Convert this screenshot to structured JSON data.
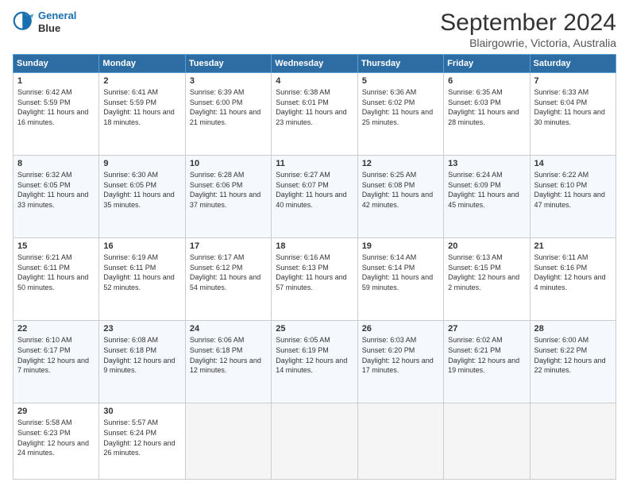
{
  "header": {
    "logo_line1": "General",
    "logo_line2": "Blue",
    "title": "September 2024",
    "subtitle": "Blairgowrie, Victoria, Australia"
  },
  "days_of_week": [
    "Sunday",
    "Monday",
    "Tuesday",
    "Wednesday",
    "Thursday",
    "Friday",
    "Saturday"
  ],
  "weeks": [
    [
      {
        "day": "1",
        "rise": "6:42 AM",
        "set": "5:59 PM",
        "daylight": "11 hours and 16 minutes."
      },
      {
        "day": "2",
        "rise": "6:41 AM",
        "set": "5:59 PM",
        "daylight": "11 hours and 18 minutes."
      },
      {
        "day": "3",
        "rise": "6:39 AM",
        "set": "6:00 PM",
        "daylight": "11 hours and 21 minutes."
      },
      {
        "day": "4",
        "rise": "6:38 AM",
        "set": "6:01 PM",
        "daylight": "11 hours and 23 minutes."
      },
      {
        "day": "5",
        "rise": "6:36 AM",
        "set": "6:02 PM",
        "daylight": "11 hours and 25 minutes."
      },
      {
        "day": "6",
        "rise": "6:35 AM",
        "set": "6:03 PM",
        "daylight": "11 hours and 28 minutes."
      },
      {
        "day": "7",
        "rise": "6:33 AM",
        "set": "6:04 PM",
        "daylight": "11 hours and 30 minutes."
      }
    ],
    [
      {
        "day": "8",
        "rise": "6:32 AM",
        "set": "6:05 PM",
        "daylight": "11 hours and 33 minutes."
      },
      {
        "day": "9",
        "rise": "6:30 AM",
        "set": "6:05 PM",
        "daylight": "11 hours and 35 minutes."
      },
      {
        "day": "10",
        "rise": "6:28 AM",
        "set": "6:06 PM",
        "daylight": "11 hours and 37 minutes."
      },
      {
        "day": "11",
        "rise": "6:27 AM",
        "set": "6:07 PM",
        "daylight": "11 hours and 40 minutes."
      },
      {
        "day": "12",
        "rise": "6:25 AM",
        "set": "6:08 PM",
        "daylight": "11 hours and 42 minutes."
      },
      {
        "day": "13",
        "rise": "6:24 AM",
        "set": "6:09 PM",
        "daylight": "11 hours and 45 minutes."
      },
      {
        "day": "14",
        "rise": "6:22 AM",
        "set": "6:10 PM",
        "daylight": "11 hours and 47 minutes."
      }
    ],
    [
      {
        "day": "15",
        "rise": "6:21 AM",
        "set": "6:11 PM",
        "daylight": "11 hours and 50 minutes."
      },
      {
        "day": "16",
        "rise": "6:19 AM",
        "set": "6:11 PM",
        "daylight": "11 hours and 52 minutes."
      },
      {
        "day": "17",
        "rise": "6:17 AM",
        "set": "6:12 PM",
        "daylight": "11 hours and 54 minutes."
      },
      {
        "day": "18",
        "rise": "6:16 AM",
        "set": "6:13 PM",
        "daylight": "11 hours and 57 minutes."
      },
      {
        "day": "19",
        "rise": "6:14 AM",
        "set": "6:14 PM",
        "daylight": "11 hours and 59 minutes."
      },
      {
        "day": "20",
        "rise": "6:13 AM",
        "set": "6:15 PM",
        "daylight": "12 hours and 2 minutes."
      },
      {
        "day": "21",
        "rise": "6:11 AM",
        "set": "6:16 PM",
        "daylight": "12 hours and 4 minutes."
      }
    ],
    [
      {
        "day": "22",
        "rise": "6:10 AM",
        "set": "6:17 PM",
        "daylight": "12 hours and 7 minutes."
      },
      {
        "day": "23",
        "rise": "6:08 AM",
        "set": "6:18 PM",
        "daylight": "12 hours and 9 minutes."
      },
      {
        "day": "24",
        "rise": "6:06 AM",
        "set": "6:18 PM",
        "daylight": "12 hours and 12 minutes."
      },
      {
        "day": "25",
        "rise": "6:05 AM",
        "set": "6:19 PM",
        "daylight": "12 hours and 14 minutes."
      },
      {
        "day": "26",
        "rise": "6:03 AM",
        "set": "6:20 PM",
        "daylight": "12 hours and 17 minutes."
      },
      {
        "day": "27",
        "rise": "6:02 AM",
        "set": "6:21 PM",
        "daylight": "12 hours and 19 minutes."
      },
      {
        "day": "28",
        "rise": "6:00 AM",
        "set": "6:22 PM",
        "daylight": "12 hours and 22 minutes."
      }
    ],
    [
      {
        "day": "29",
        "rise": "5:58 AM",
        "set": "6:23 PM",
        "daylight": "12 hours and 24 minutes."
      },
      {
        "day": "30",
        "rise": "5:57 AM",
        "set": "6:24 PM",
        "daylight": "12 hours and 26 minutes."
      },
      null,
      null,
      null,
      null,
      null
    ]
  ]
}
